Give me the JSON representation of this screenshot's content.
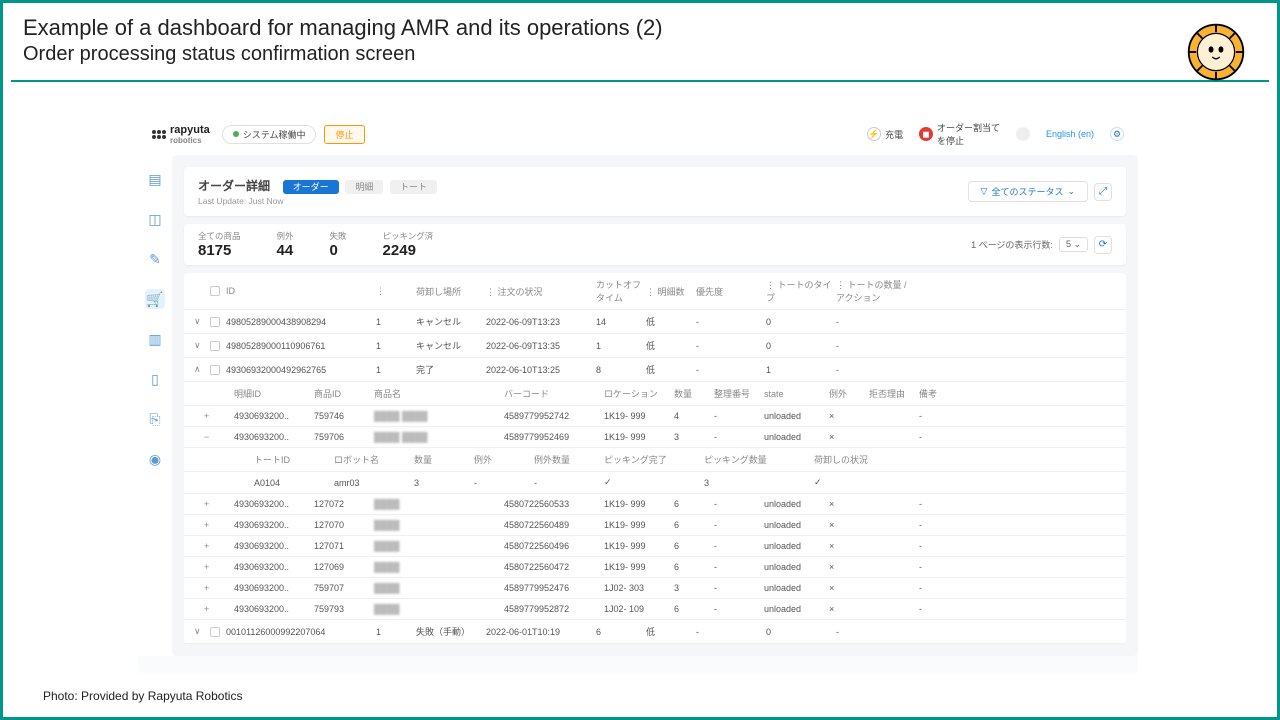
{
  "slide": {
    "title": "Example of a dashboard for managing AMR and its operations (2)",
    "subtitle": "Order processing status confirmation screen",
    "credit": "Photo: Provided by Rapyuta Robotics"
  },
  "brand": {
    "line1": "rapyuta",
    "line2": "robotics"
  },
  "topbar": {
    "status": "システム稼働中",
    "stop": "停止",
    "charge": "充電",
    "order_stop_l1": "オーダー割当て",
    "order_stop_l2": "を停止",
    "lang": "English (en)"
  },
  "panel": {
    "title": "オーダー詳細",
    "tab_order": "オーダー",
    "tab_detail": "明細",
    "tab_tote": "トート",
    "updated": "Last Update: Just Now",
    "filter": "全てのステータス"
  },
  "stats": {
    "all_label": "全ての商品",
    "all_val": "8175",
    "exc_label": "例外",
    "exc_val": "44",
    "fail_label": "失敗",
    "fail_val": "0",
    "pick_label": "ピッキング済",
    "pick_val": "2249",
    "rows_label": "1 ページの表示行数:",
    "rows_val": "5"
  },
  "cols": {
    "id": "ID",
    "drop": "荷卸し場所",
    "status": "注文の状況",
    "cutoff": "カットオフタイム",
    "details": "明細数",
    "priority": "優先度",
    "tote_type": "トートのタイプ",
    "tote_qty": "トートの数量",
    "action": "アクション"
  },
  "rows": [
    {
      "exp": "∨",
      "id": "49805289000438908294",
      "drop": "1",
      "status": "キャンセル",
      "cutoff": "2022-06-09T13:23",
      "details": "14",
      "priority": "低",
      "tote_type": "-",
      "tote_qty": "0",
      "action": "-"
    },
    {
      "exp": "∨",
      "id": "49805289000110906761",
      "drop": "1",
      "status": "キャンセル",
      "cutoff": "2022-06-09T13:35",
      "details": "1",
      "priority": "低",
      "tote_type": "-",
      "tote_qty": "0",
      "action": "-"
    },
    {
      "exp": "∧",
      "id": "49306932000492962765",
      "drop": "1",
      "status": "完了",
      "cutoff": "2022-06-10T13:25",
      "details": "8",
      "priority": "低",
      "tote_type": "-",
      "tote_qty": "1",
      "action": "-"
    }
  ],
  "subcols": {
    "detail_id": "明細ID",
    "prod_id": "商品ID",
    "prod_name": "商品名",
    "barcode": "バーコード",
    "location": "ロケーション",
    "qty": "数量",
    "seq": "整理番号",
    "state": "state",
    "exc": "例外",
    "reject": "拒否理由",
    "remarks": "備考"
  },
  "subrows_a": [
    {
      "exp": "+",
      "did": "4930693200..",
      "pid": "759746",
      "name": "████ ████",
      "bc": "4589779952742",
      "loc": "1K19- 999",
      "qty": "4",
      "seq": "-",
      "state": "unloaded",
      "exc": "×",
      "rej": "",
      "rem": "-"
    },
    {
      "exp": "−",
      "did": "4930693200..",
      "pid": "759706",
      "name": "████ ████",
      "bc": "4589779952469",
      "loc": "1K19- 999",
      "qty": "3",
      "seq": "-",
      "state": "unloaded",
      "exc": "×",
      "rej": "",
      "rem": "-"
    }
  ],
  "sscols": {
    "tote_id": "トートID",
    "robot": "ロボット名",
    "qty": "数量",
    "exc": "例外",
    "exc_qty": "例外数量",
    "pick_done": "ピッキング完了",
    "pick_qty": "ピッキング数量",
    "unload": "荷卸しの状況"
  },
  "ssrow": {
    "tote": "A0104",
    "robot": "amr03",
    "qty": "3",
    "exc": "-",
    "exc_qty": "-",
    "done": "✓",
    "pqty": "3",
    "unload": "✓"
  },
  "subrows_b": [
    {
      "exp": "+",
      "did": "4930693200..",
      "pid": "127072",
      "name": "████",
      "bc": "4580722560533",
      "loc": "1K19- 999",
      "qty": "6",
      "seq": "-",
      "state": "unloaded",
      "exc": "×",
      "rej": "",
      "rem": "-"
    },
    {
      "exp": "+",
      "did": "4930693200..",
      "pid": "127070",
      "name": "████",
      "bc": "4580722560489",
      "loc": "1K19- 999",
      "qty": "6",
      "seq": "-",
      "state": "unloaded",
      "exc": "×",
      "rej": "",
      "rem": "-"
    },
    {
      "exp": "+",
      "did": "4930693200..",
      "pid": "127071",
      "name": "████",
      "bc": "4580722560496",
      "loc": "1K19- 999",
      "qty": "6",
      "seq": "-",
      "state": "unloaded",
      "exc": "×",
      "rej": "",
      "rem": "-"
    },
    {
      "exp": "+",
      "did": "4930693200..",
      "pid": "127069",
      "name": "████",
      "bc": "4580722560472",
      "loc": "1K19- 999",
      "qty": "6",
      "seq": "-",
      "state": "unloaded",
      "exc": "×",
      "rej": "",
      "rem": "-"
    },
    {
      "exp": "+",
      "did": "4930693200..",
      "pid": "759707",
      "name": "████",
      "bc": "4589779952476",
      "loc": "1J02- 303",
      "qty": "3",
      "seq": "-",
      "state": "unloaded",
      "exc": "×",
      "rej": "",
      "rem": "-"
    },
    {
      "exp": "+",
      "did": "4930693200..",
      "pid": "759793",
      "name": "████",
      "bc": "4589779952872",
      "loc": "1J02- 109",
      "qty": "6",
      "seq": "-",
      "state": "unloaded",
      "exc": "×",
      "rej": "",
      "rem": "-"
    }
  ],
  "last_row": {
    "exp": "∨",
    "id": "00101126000992207064",
    "drop": "1",
    "status": "失敗（手動）",
    "cutoff": "2022-06-01T10:19",
    "details": "6",
    "priority": "低",
    "tote_type": "-",
    "tote_qty": "0",
    "action": "-"
  }
}
